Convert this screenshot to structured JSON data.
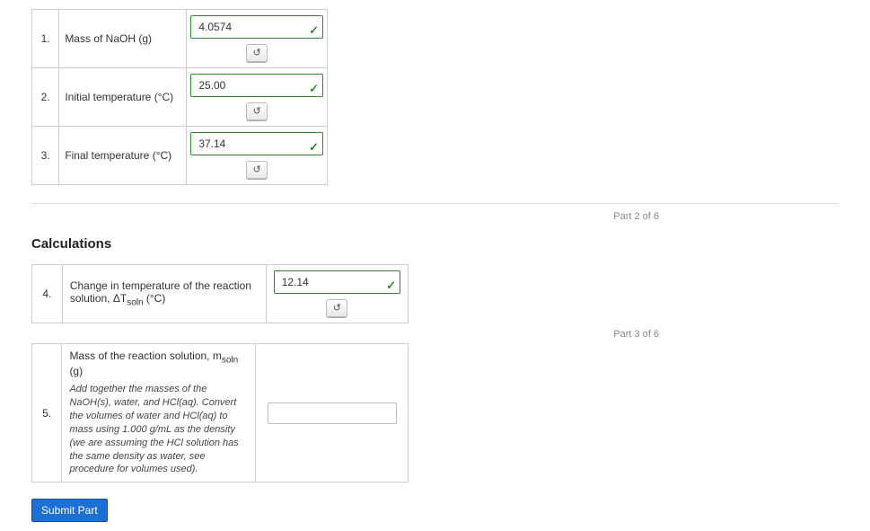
{
  "rows": [
    {
      "num": "1.",
      "label": "Mass of NaOH (g)",
      "value": "4.0574"
    },
    {
      "num": "2.",
      "label": "Initial temperature (°C)",
      "value": "25.00"
    },
    {
      "num": "3.",
      "label": "Final temperature (°C)",
      "value": "37.14"
    }
  ],
  "part2": "Part 2 of 6",
  "calc_heading": "Calculations",
  "row4": {
    "num": "4.",
    "label_pre": "Change in temperature of the reaction solution, ΔT",
    "label_sub": "soln",
    "label_post": " (°C)",
    "value": "12.14"
  },
  "part3": "Part 3 of 6",
  "row5": {
    "num": "5.",
    "label_pre": "Mass of the reaction solution, m",
    "label_sub": "soln",
    "label_post": " (g)",
    "hint": "Add together the masses of the NaOH(s), water, and HCl(aq). Convert the volumes of water and HCl(aq) to mass using 1.000 g/mL as the density (we are assuming the HCl solution has the same density as water, see procedure for volumes used)."
  },
  "retry_icon": "↺",
  "check_icon": "✓",
  "submit": "Submit Part"
}
